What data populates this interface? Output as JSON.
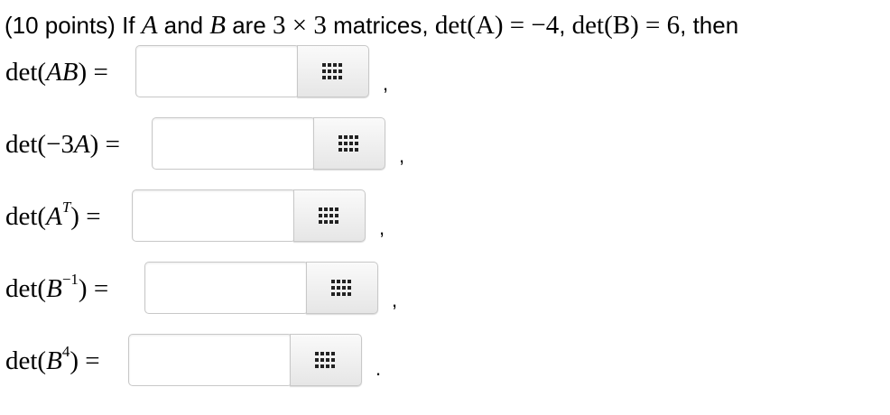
{
  "header": {
    "prefix": "(10 points) If ",
    "var_a": "A",
    "and": " and ",
    "var_b": "B",
    "are": " are ",
    "dims": "3 × 3",
    "mid": " matrices, ",
    "det_a": "det(A) = −4",
    "comma1": ", ",
    "det_b": "det(B) = 6",
    "suffix": ", then"
  },
  "rows": [
    {
      "label_pre": "det(",
      "label_var": "AB",
      "label_sup": "",
      "label_post": ") =",
      "value": "",
      "punct": ","
    },
    {
      "label_pre": "det(−3",
      "label_var": "A",
      "label_sup": "",
      "label_post": ") =",
      "value": "",
      "punct": ","
    },
    {
      "label_pre": "det(",
      "label_var": "A",
      "label_sup": "T",
      "label_post": ") =",
      "value": "",
      "punct": ","
    },
    {
      "label_pre": "det(",
      "label_var": "B",
      "label_sup": "−1",
      "label_post": ") =",
      "value": "",
      "punct": ","
    },
    {
      "label_pre": "det(",
      "label_var": "B",
      "label_sup": "4",
      "label_post": ") =",
      "value": "",
      "punct": "."
    }
  ],
  "palette_icon": "grid-icon"
}
